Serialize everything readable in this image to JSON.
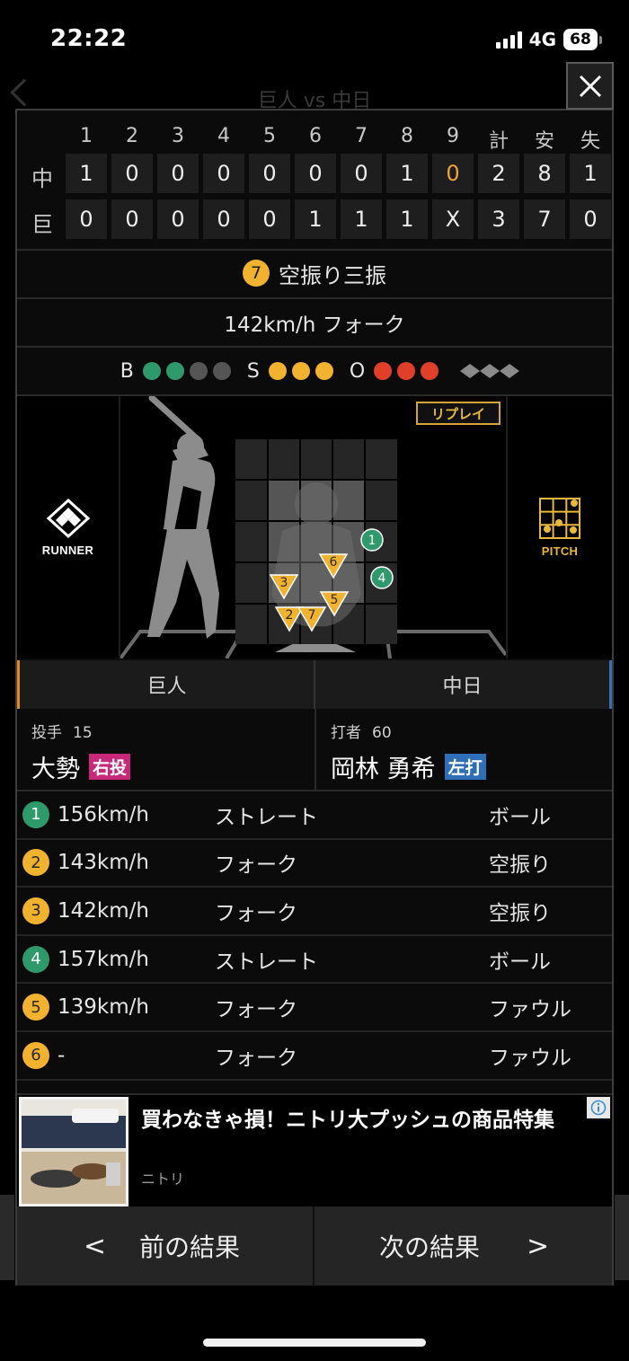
{
  "status_bar": {
    "time": "22:22",
    "network": "4G",
    "battery": "68"
  },
  "background": {
    "title": "巨人 vs 中日"
  },
  "scoreboard": {
    "innings": [
      "1",
      "2",
      "3",
      "4",
      "5",
      "6",
      "7",
      "8",
      "9"
    ],
    "totals_headers": [
      "計",
      "安",
      "失"
    ],
    "teams": [
      {
        "name": "中",
        "scores": [
          "1",
          "0",
          "0",
          "0",
          "0",
          "0",
          "0",
          "1",
          "0"
        ],
        "totals": [
          "2",
          "8",
          "1"
        ]
      },
      {
        "name": "巨",
        "scores": [
          "0",
          "0",
          "0",
          "0",
          "0",
          "1",
          "1",
          "1",
          "X"
        ],
        "totals": [
          "3",
          "7",
          "0"
        ]
      }
    ],
    "highlight_color": "#f2a23a"
  },
  "play": {
    "number": "7",
    "result": "空振り三振",
    "pitch_info": "142km/h フォーク"
  },
  "count": {
    "balls_label": "B",
    "strikes_label": "S",
    "outs_label": "O",
    "balls": 2,
    "balls_max": 4,
    "strikes": 3,
    "strikes_max": 3,
    "outs": 3,
    "outs_max": 3,
    "colors": {
      "ball": "#2e9a6b",
      "strike": "#f1b230",
      "out": "#e0402a",
      "empty": "#555555"
    }
  },
  "field": {
    "runner_label": "RUNNER",
    "pitch_label": "PITCH",
    "replay_label": "リプレイ",
    "pitches": [
      {
        "n": "1",
        "kind": "straight",
        "color": "#2e9a6b"
      },
      {
        "n": "2",
        "kind": "fork",
        "color": "#f1b230"
      },
      {
        "n": "3",
        "kind": "fork",
        "color": "#f1b230"
      },
      {
        "n": "4",
        "kind": "straight",
        "color": "#2e9a6b"
      },
      {
        "n": "5",
        "kind": "fork",
        "color": "#f1b230"
      },
      {
        "n": "6",
        "kind": "fork",
        "color": "#f1b230"
      },
      {
        "n": "7",
        "kind": "fork",
        "color": "#f1b230"
      }
    ]
  },
  "matchup": {
    "home_team": "巨人",
    "away_team": "中日",
    "pitcher": {
      "role": "投手",
      "number": "15",
      "name": "大勢",
      "hand": "右投",
      "hand_color": "#c8287a"
    },
    "batter": {
      "role": "打者",
      "number": "60",
      "name": "岡林 勇希",
      "hand": "左打",
      "hand_color": "#2f6fb8"
    },
    "home_color": "#e08a2a",
    "away_color": "#3a6fb4"
  },
  "pitch_list": [
    {
      "n": "1",
      "speed": "156km/h",
      "type": "ストレート",
      "result": "ボール",
      "color": "#2e9a6b"
    },
    {
      "n": "2",
      "speed": "143km/h",
      "type": "フォーク",
      "result": "空振り",
      "color": "#f1b230"
    },
    {
      "n": "3",
      "speed": "142km/h",
      "type": "フォーク",
      "result": "空振り",
      "color": "#f1b230"
    },
    {
      "n": "4",
      "speed": "157km/h",
      "type": "ストレート",
      "result": "ボール",
      "color": "#2e9a6b"
    },
    {
      "n": "5",
      "speed": "139km/h",
      "type": "フォーク",
      "result": "ファウル",
      "color": "#f1b230"
    },
    {
      "n": "6",
      "speed": "-",
      "type": "フォーク",
      "result": "ファウル",
      "color": "#f1b230"
    }
  ],
  "ad": {
    "title": "買わなきゃ損！ニトリ大プッシュの商品特集",
    "sponsor": "ニトリ",
    "badge_icon": "info-icon"
  },
  "nav": {
    "prev_arrow": "<",
    "prev_label": "前の結果",
    "next_label": "次の結果",
    "next_arrow": ">"
  }
}
